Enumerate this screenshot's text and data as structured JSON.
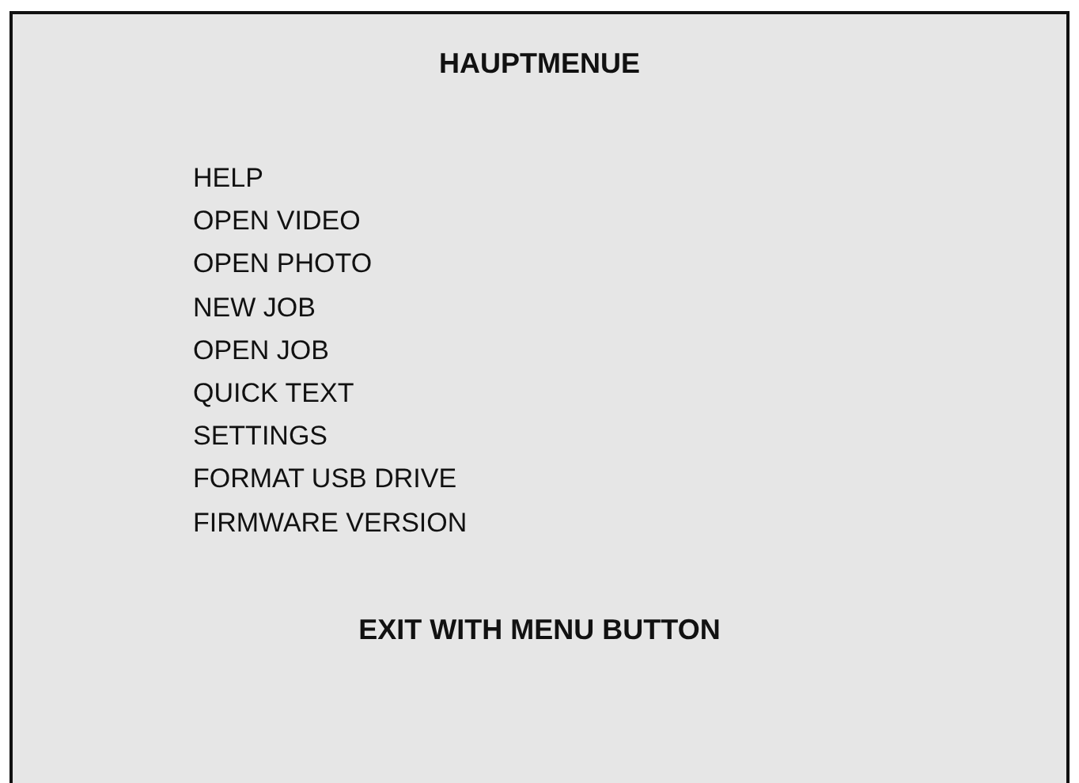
{
  "title": "HAUPTMENUE",
  "items": [
    {
      "label": "HELP"
    },
    {
      "label": "OPEN VIDEO"
    },
    {
      "label": "OPEN PHOTO"
    },
    {
      "label": "NEW JOB"
    },
    {
      "label": "OPEN JOB"
    },
    {
      "label": "QUICK TEXT"
    },
    {
      "label": "SETTINGS"
    },
    {
      "label": "FORMAT USB DRIVE"
    },
    {
      "label": "FIRMWARE VERSION"
    }
  ],
  "footer": "EXIT WITH MENU BUTTON"
}
